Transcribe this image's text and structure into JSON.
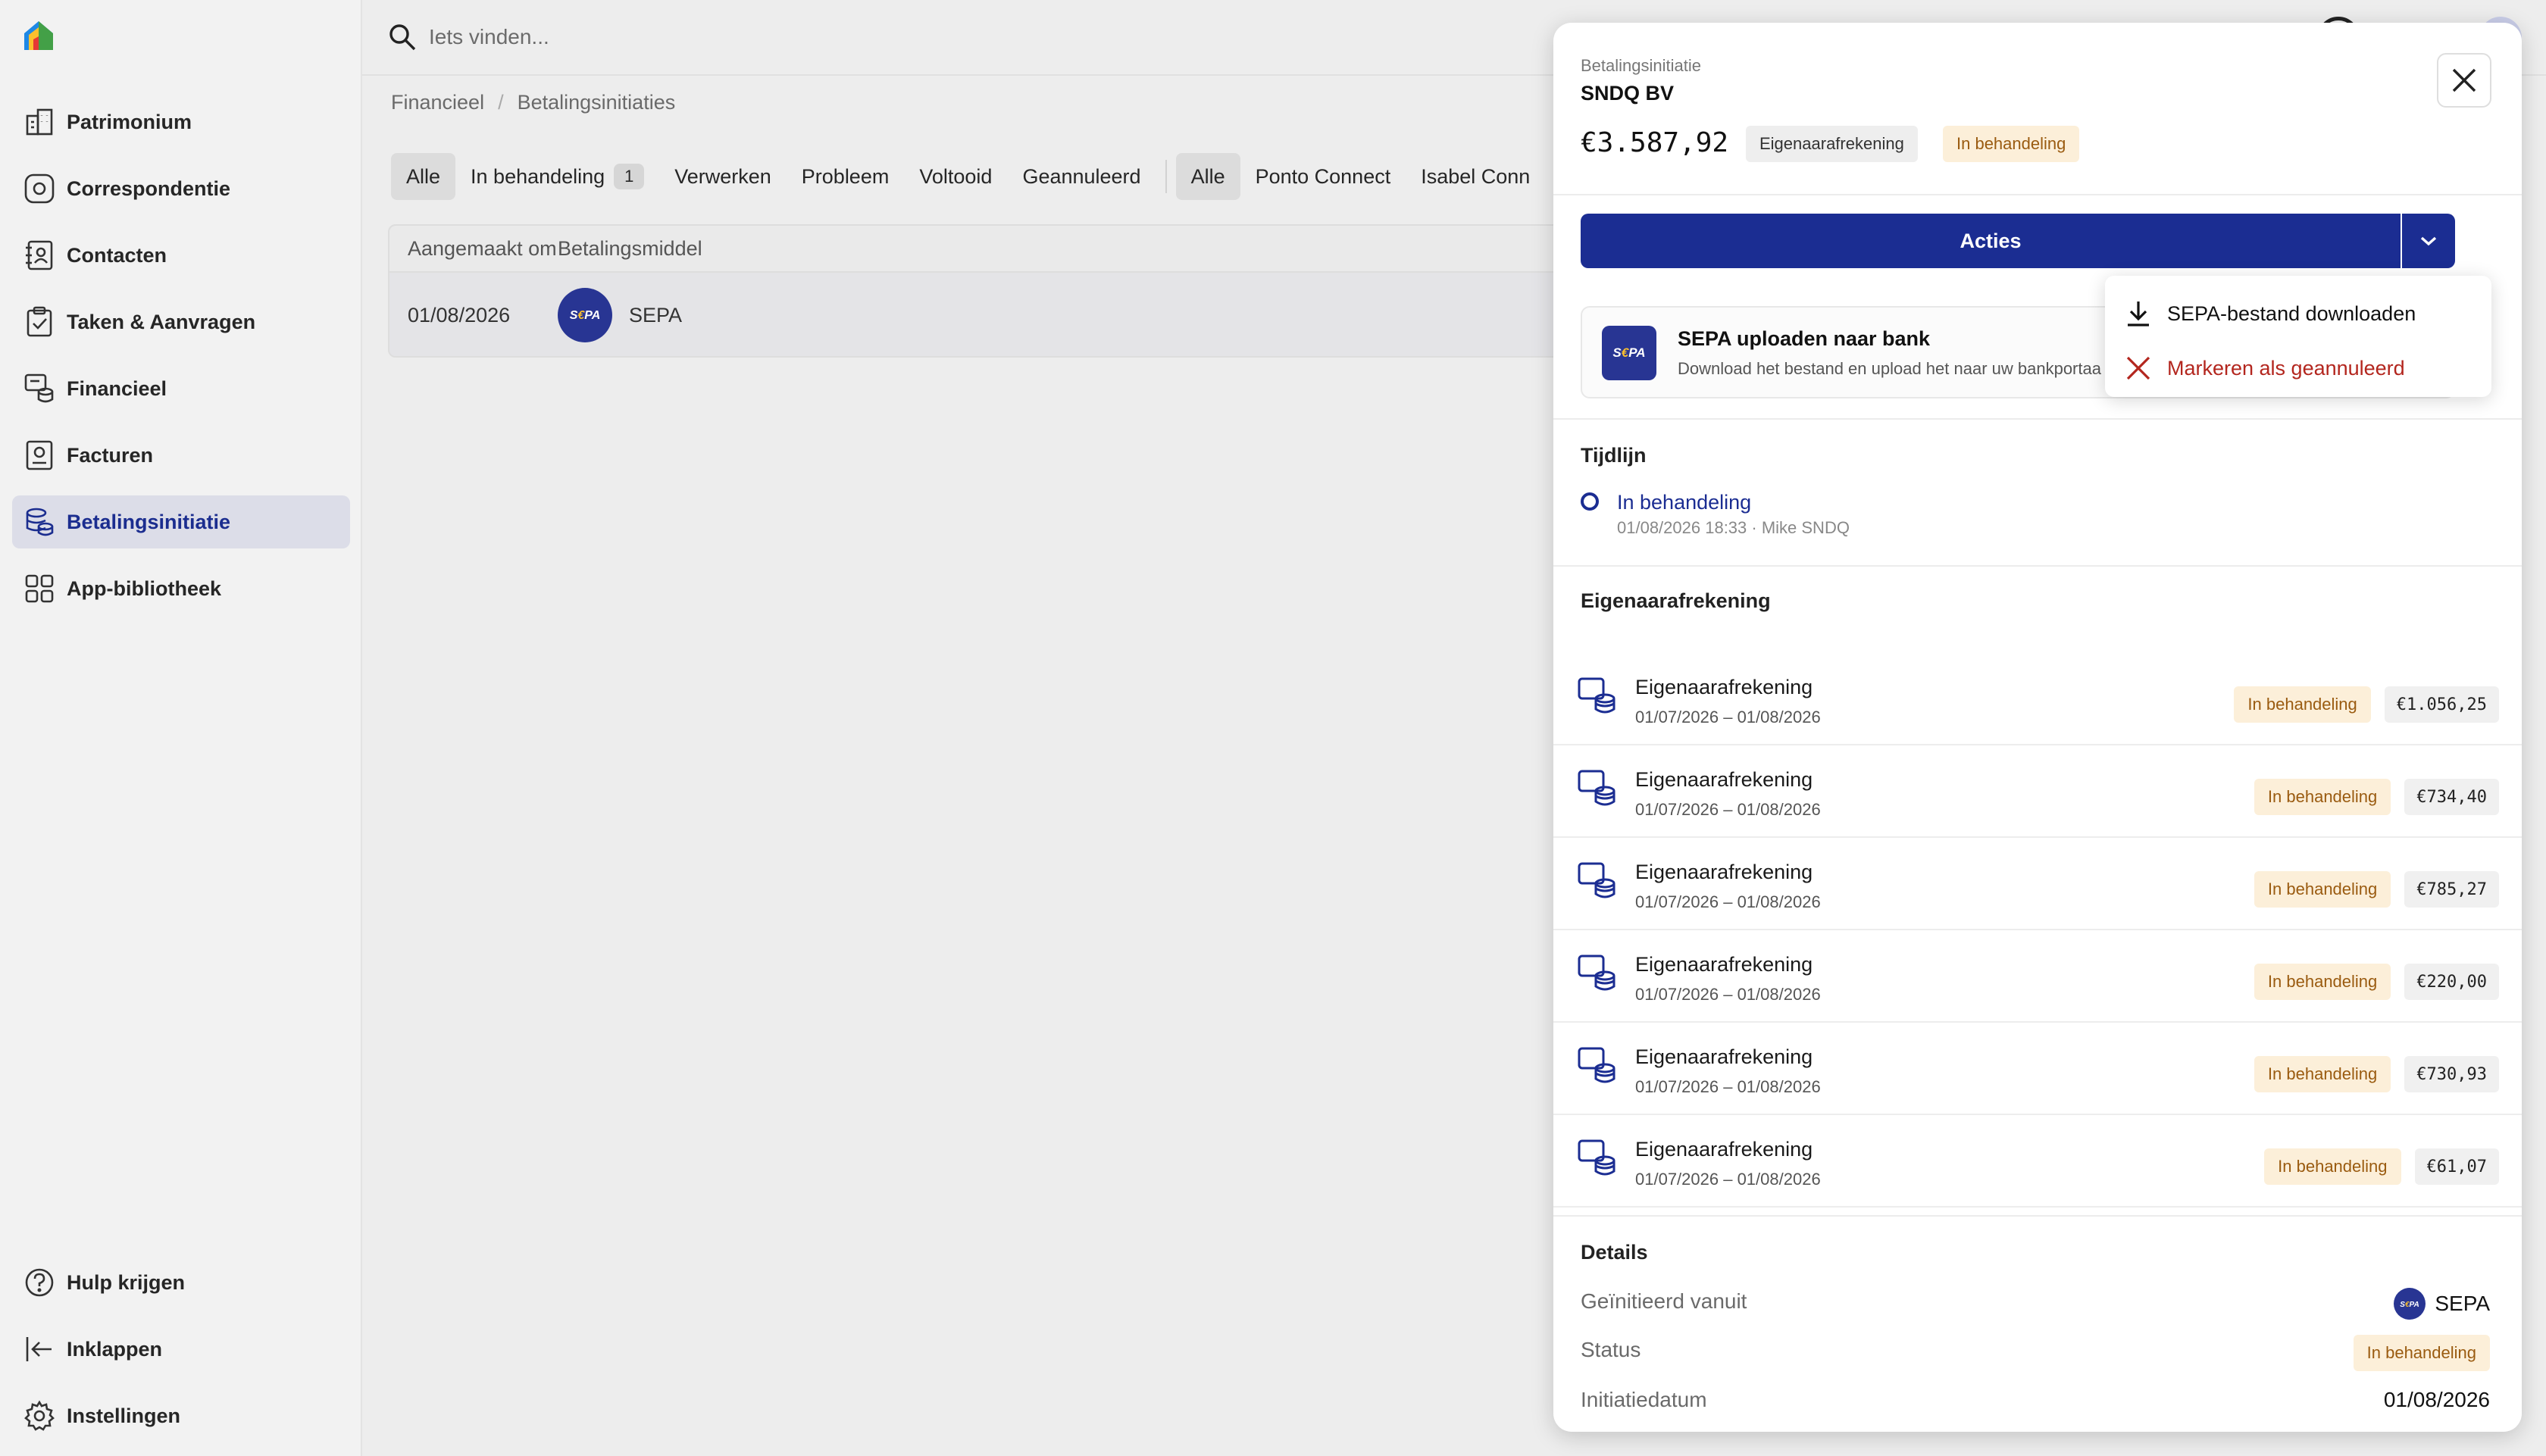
{
  "search": {
    "placeholder": "Iets vinden..."
  },
  "sidebar": {
    "items": [
      {
        "label": "Patrimonium"
      },
      {
        "label": "Correspondentie"
      },
      {
        "label": "Contacten"
      },
      {
        "label": "Taken & Aanvragen"
      },
      {
        "label": "Financieel"
      },
      {
        "label": "Facturen"
      },
      {
        "label": "Betalingsinitiatie"
      },
      {
        "label": "App-bibliotheek"
      }
    ],
    "bottom": [
      {
        "label": "Hulp krijgen"
      },
      {
        "label": "Inklappen"
      },
      {
        "label": "Instellingen"
      }
    ]
  },
  "breadcrumb": {
    "parent": "Financieel",
    "separator": "/",
    "current": "Betalingsinitiaties"
  },
  "filters": {
    "status": [
      {
        "label": "Alle"
      },
      {
        "label": "In behandeling",
        "count": "1"
      },
      {
        "label": "Verwerken"
      },
      {
        "label": "Probleem"
      },
      {
        "label": "Voltooid"
      },
      {
        "label": "Geannuleerd"
      }
    ],
    "source": [
      {
        "label": "Alle"
      },
      {
        "label": "Ponto Connect"
      },
      {
        "label": "Isabel Conn"
      }
    ]
  },
  "table": {
    "headers": {
      "created": "Aangemaakt om",
      "method": "Betalingsmiddel"
    },
    "rows": [
      {
        "created": "01/08/2026",
        "method": "SEPA"
      }
    ]
  },
  "panel": {
    "subtitle": "Betalingsinitiatie",
    "title": "SNDQ BV",
    "amount": "€3.587,92",
    "type_tag": "Eigenaarafrekening",
    "status_tag": "In behandeling",
    "actions_label": "Acties",
    "upload": {
      "logo_text": "S€PA",
      "title": "SEPA uploaden naar bank",
      "description": "Download het bestand en upload het naar uw bankportaal"
    },
    "dropdown": {
      "download": "SEPA-bestand downloaden",
      "cancel": "Markeren als geannuleerd"
    },
    "timeline": {
      "label": "Tijdlijn",
      "status": "In behandeling",
      "meta": "01/08/2026 18:33 · Mike SNDQ"
    },
    "settlements": {
      "label": "Eigenaarafrekening",
      "items": [
        {
          "title": "Eigenaarafrekening",
          "period": "01/07/2026 – 01/08/2026",
          "status": "In behandeling",
          "amount": "€1.056,25"
        },
        {
          "title": "Eigenaarafrekening",
          "period": "01/07/2026 – 01/08/2026",
          "status": "In behandeling",
          "amount": "€734,40"
        },
        {
          "title": "Eigenaarafrekening",
          "period": "01/07/2026 – 01/08/2026",
          "status": "In behandeling",
          "amount": "€785,27"
        },
        {
          "title": "Eigenaarafrekening",
          "period": "01/07/2026 – 01/08/2026",
          "status": "In behandeling",
          "amount": "€220,00"
        },
        {
          "title": "Eigenaarafrekening",
          "period": "01/07/2026 – 01/08/2026",
          "status": "In behandeling",
          "amount": "€730,93"
        },
        {
          "title": "Eigenaarafrekening",
          "period": "01/07/2026 – 01/08/2026",
          "status": "In behandeling",
          "amount": "€61,07"
        }
      ]
    },
    "details": {
      "label": "Details",
      "initiated_label": "Geïnitieerd vanuit",
      "initiated_value": "SEPA",
      "status_label": "Status",
      "status_value": "In behandeling",
      "date_label": "Initiatiedatum",
      "date_value": "01/08/2026"
    }
  },
  "colors": {
    "accent": "#1b2d92",
    "danger": "#b3261e",
    "pending_bg": "#fcefd9",
    "pending_text": "#9a5b10",
    "sepa": "#283593"
  }
}
